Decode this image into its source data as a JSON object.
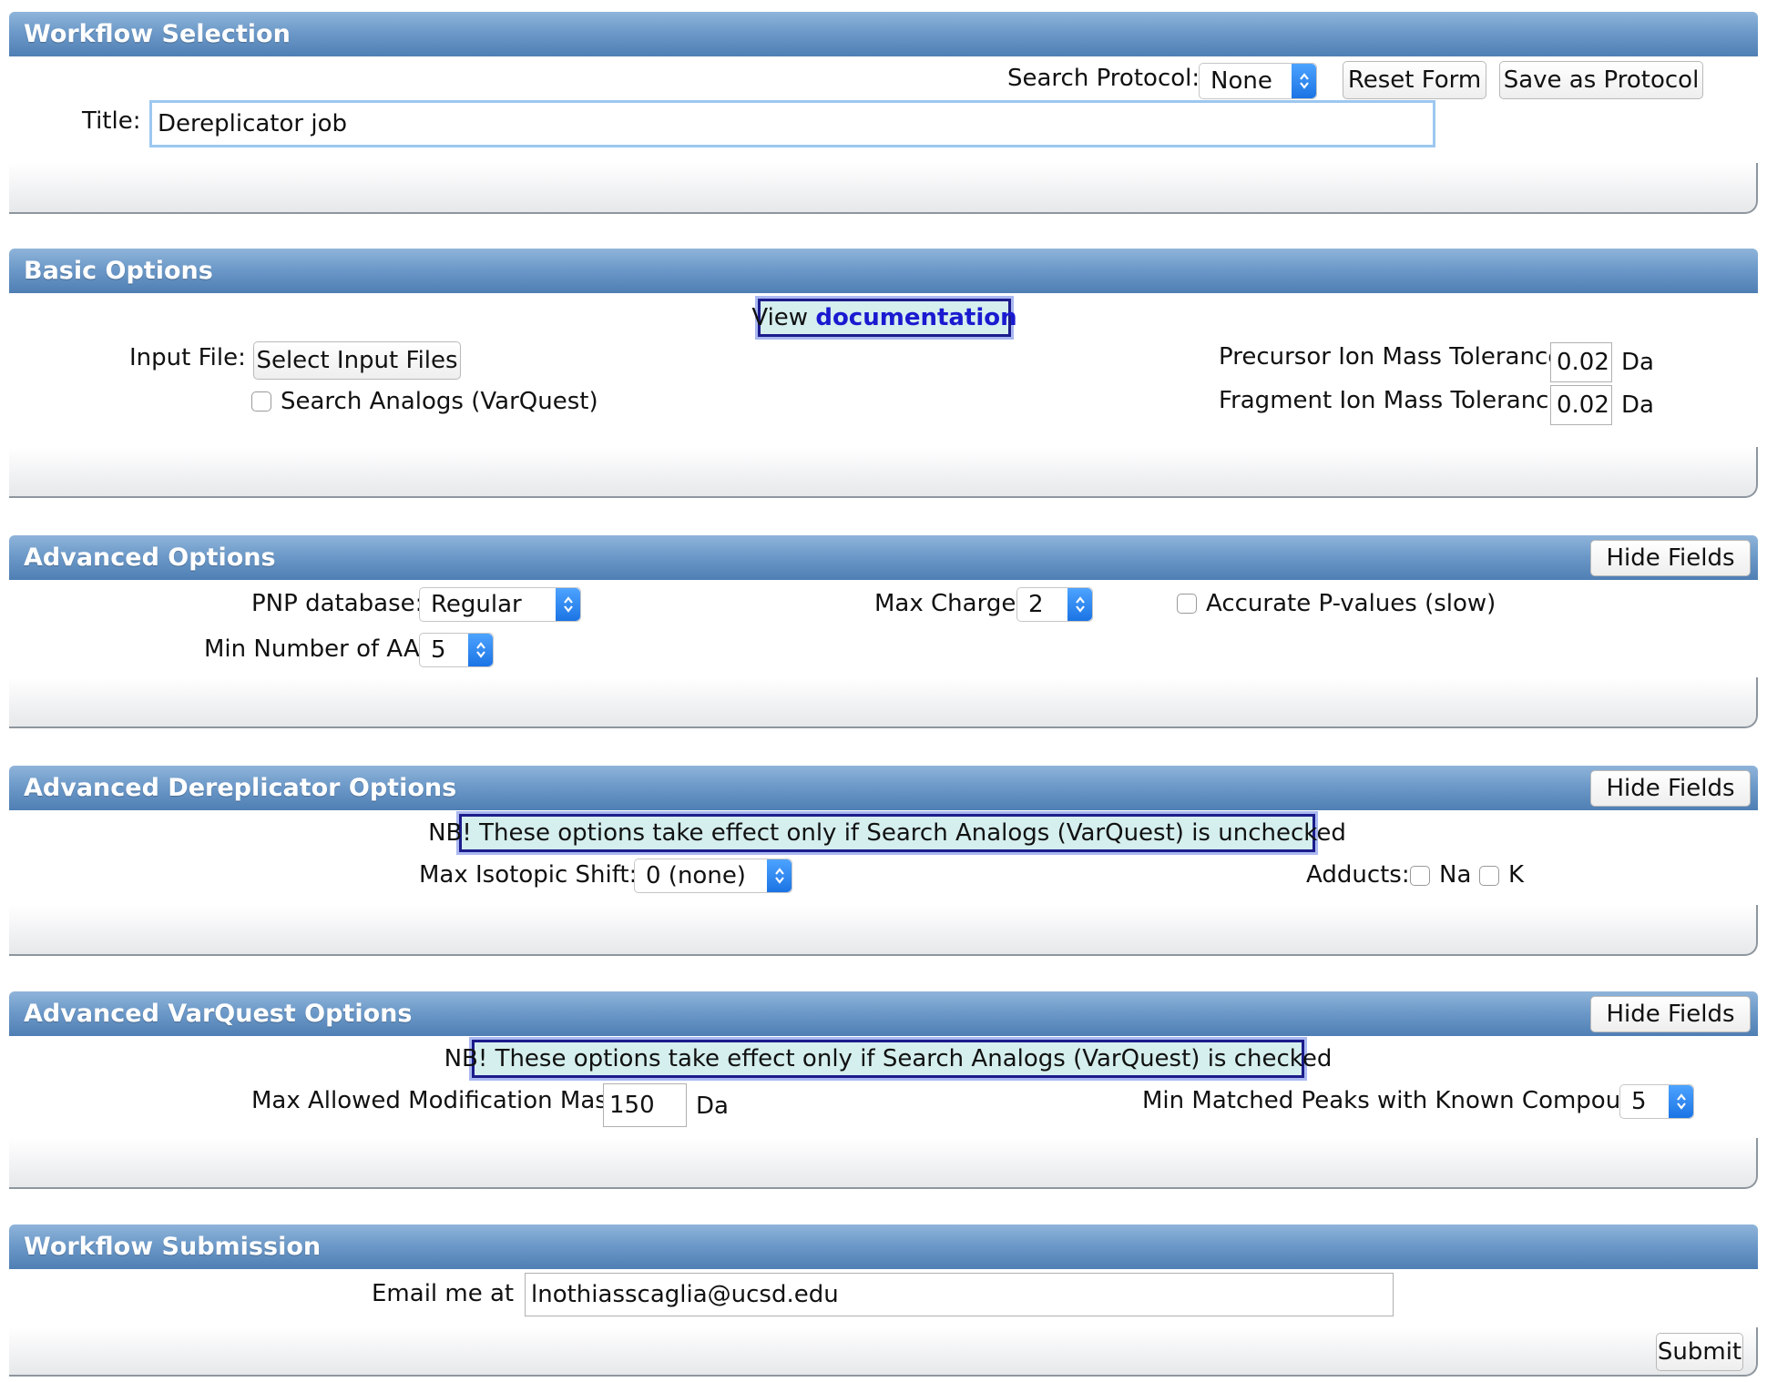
{
  "workflow_selection": {
    "header": "Workflow Selection",
    "protocol_label": "Search Protocol:",
    "protocol_value": "None",
    "reset_label": "Reset Form",
    "save_label": "Save as Protocol",
    "title_label": "Title:",
    "title_value": "Dereplicator job"
  },
  "basic_options": {
    "header": "Basic Options",
    "doc_prefix": "View",
    "doc_link": "documentation",
    "input_file_label": "Input File:",
    "select_files_label": "Select Input Files",
    "search_analogs_label": "Search Analogs (VarQuest)",
    "precursor_label": "Precursor Ion Mass Tolerance:",
    "precursor_value": "0.02",
    "precursor_unit": "Da",
    "fragment_label": "Fragment Ion Mass Tolerance:",
    "fragment_value": "0.02",
    "fragment_unit": "Da"
  },
  "advanced_options": {
    "header": "Advanced Options",
    "hide_label": "Hide Fields",
    "pnp_label": "PNP database:",
    "pnp_value": "Regular",
    "max_charge_label": "Max Charge:",
    "max_charge_value": "2",
    "accurate_label": "Accurate P-values (slow)",
    "min_aa_label": "Min Number of AA:",
    "min_aa_value": "5"
  },
  "dereplicator_options": {
    "header": "Advanced Dereplicator Options",
    "hide_label": "Hide Fields",
    "note": "NB! These options take effect only if Search Analogs (VarQuest) is unchecked",
    "isotopic_label": "Max Isotopic Shift:",
    "isotopic_value": "0 (none)",
    "adducts_label": "Adducts:",
    "adduct_na": "Na",
    "adduct_k": "K"
  },
  "varquest_options": {
    "header": "Advanced VarQuest Options",
    "hide_label": "Hide Fields",
    "note": "NB! These options take effect only if Search Analogs (VarQuest) is checked",
    "max_mod_label": "Max Allowed Modification Mass:",
    "max_mod_value": "150",
    "max_mod_unit": "Da",
    "min_peaks_label": "Min Matched Peaks with Known Compound:",
    "min_peaks_value": "5"
  },
  "submission": {
    "header": "Workflow Submission",
    "email_label": "Email me at",
    "email_value": "lnothiasscaglia@ucsd.edu",
    "submit_label": "Submit"
  },
  "colors": {
    "header_top": "#8fb4da",
    "header_bottom": "#4f7fb4",
    "note_bg": "#d5eeee",
    "link": "#1a1ad0",
    "select_arrow": "#1b74e4"
  },
  "icons": {
    "select_arrow": "updown-chevron-icon"
  }
}
